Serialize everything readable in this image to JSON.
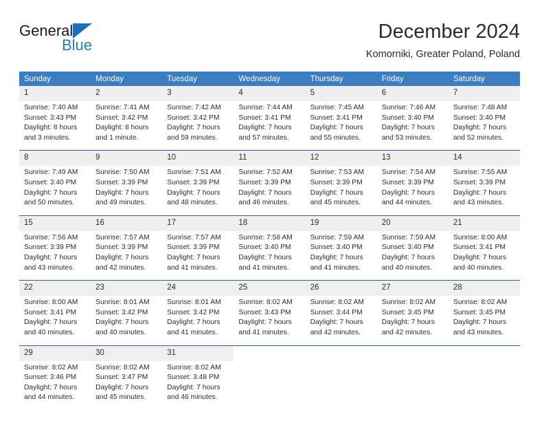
{
  "logo": {
    "word1": "General",
    "word2": "Blue",
    "triangle_color": "#1f6fc0",
    "word2_color": "#1f7ac4"
  },
  "header": {
    "title": "December 2024",
    "location": "Komorniki, Greater Poland, Poland"
  },
  "theme": {
    "header_blue": "#3a7dc0",
    "separator_blue": "#2a5f9e",
    "daynum_bg": "#efefef",
    "text": "#2b2b2b"
  },
  "weekday_headers": [
    "Sunday",
    "Monday",
    "Tuesday",
    "Wednesday",
    "Thursday",
    "Friday",
    "Saturday"
  ],
  "weeks": [
    [
      {
        "day": "1",
        "sunrise": "Sunrise: 7:40 AM",
        "sunset": "Sunset: 3:43 PM",
        "daylight1": "Daylight: 8 hours",
        "daylight2": "and 3 minutes."
      },
      {
        "day": "2",
        "sunrise": "Sunrise: 7:41 AM",
        "sunset": "Sunset: 3:42 PM",
        "daylight1": "Daylight: 8 hours",
        "daylight2": "and 1 minute."
      },
      {
        "day": "3",
        "sunrise": "Sunrise: 7:42 AM",
        "sunset": "Sunset: 3:42 PM",
        "daylight1": "Daylight: 7 hours",
        "daylight2": "and 59 minutes."
      },
      {
        "day": "4",
        "sunrise": "Sunrise: 7:44 AM",
        "sunset": "Sunset: 3:41 PM",
        "daylight1": "Daylight: 7 hours",
        "daylight2": "and 57 minutes."
      },
      {
        "day": "5",
        "sunrise": "Sunrise: 7:45 AM",
        "sunset": "Sunset: 3:41 PM",
        "daylight1": "Daylight: 7 hours",
        "daylight2": "and 55 minutes."
      },
      {
        "day": "6",
        "sunrise": "Sunrise: 7:46 AM",
        "sunset": "Sunset: 3:40 PM",
        "daylight1": "Daylight: 7 hours",
        "daylight2": "and 53 minutes."
      },
      {
        "day": "7",
        "sunrise": "Sunrise: 7:48 AM",
        "sunset": "Sunset: 3:40 PM",
        "daylight1": "Daylight: 7 hours",
        "daylight2": "and 52 minutes."
      }
    ],
    [
      {
        "day": "8",
        "sunrise": "Sunrise: 7:49 AM",
        "sunset": "Sunset: 3:40 PM",
        "daylight1": "Daylight: 7 hours",
        "daylight2": "and 50 minutes."
      },
      {
        "day": "9",
        "sunrise": "Sunrise: 7:50 AM",
        "sunset": "Sunset: 3:39 PM",
        "daylight1": "Daylight: 7 hours",
        "daylight2": "and 49 minutes."
      },
      {
        "day": "10",
        "sunrise": "Sunrise: 7:51 AM",
        "sunset": "Sunset: 3:39 PM",
        "daylight1": "Daylight: 7 hours",
        "daylight2": "and 48 minutes."
      },
      {
        "day": "11",
        "sunrise": "Sunrise: 7:52 AM",
        "sunset": "Sunset: 3:39 PM",
        "daylight1": "Daylight: 7 hours",
        "daylight2": "and 46 minutes."
      },
      {
        "day": "12",
        "sunrise": "Sunrise: 7:53 AM",
        "sunset": "Sunset: 3:39 PM",
        "daylight1": "Daylight: 7 hours",
        "daylight2": "and 45 minutes."
      },
      {
        "day": "13",
        "sunrise": "Sunrise: 7:54 AM",
        "sunset": "Sunset: 3:39 PM",
        "daylight1": "Daylight: 7 hours",
        "daylight2": "and 44 minutes."
      },
      {
        "day": "14",
        "sunrise": "Sunrise: 7:55 AM",
        "sunset": "Sunset: 3:39 PM",
        "daylight1": "Daylight: 7 hours",
        "daylight2": "and 43 minutes."
      }
    ],
    [
      {
        "day": "15",
        "sunrise": "Sunrise: 7:56 AM",
        "sunset": "Sunset: 3:39 PM",
        "daylight1": "Daylight: 7 hours",
        "daylight2": "and 43 minutes."
      },
      {
        "day": "16",
        "sunrise": "Sunrise: 7:57 AM",
        "sunset": "Sunset: 3:39 PM",
        "daylight1": "Daylight: 7 hours",
        "daylight2": "and 42 minutes."
      },
      {
        "day": "17",
        "sunrise": "Sunrise: 7:57 AM",
        "sunset": "Sunset: 3:39 PM",
        "daylight1": "Daylight: 7 hours",
        "daylight2": "and 41 minutes."
      },
      {
        "day": "18",
        "sunrise": "Sunrise: 7:58 AM",
        "sunset": "Sunset: 3:40 PM",
        "daylight1": "Daylight: 7 hours",
        "daylight2": "and 41 minutes."
      },
      {
        "day": "19",
        "sunrise": "Sunrise: 7:59 AM",
        "sunset": "Sunset: 3:40 PM",
        "daylight1": "Daylight: 7 hours",
        "daylight2": "and 41 minutes."
      },
      {
        "day": "20",
        "sunrise": "Sunrise: 7:59 AM",
        "sunset": "Sunset: 3:40 PM",
        "daylight1": "Daylight: 7 hours",
        "daylight2": "and 40 minutes."
      },
      {
        "day": "21",
        "sunrise": "Sunrise: 8:00 AM",
        "sunset": "Sunset: 3:41 PM",
        "daylight1": "Daylight: 7 hours",
        "daylight2": "and 40 minutes."
      }
    ],
    [
      {
        "day": "22",
        "sunrise": "Sunrise: 8:00 AM",
        "sunset": "Sunset: 3:41 PM",
        "daylight1": "Daylight: 7 hours",
        "daylight2": "and 40 minutes."
      },
      {
        "day": "23",
        "sunrise": "Sunrise: 8:01 AM",
        "sunset": "Sunset: 3:42 PM",
        "daylight1": "Daylight: 7 hours",
        "daylight2": "and 40 minutes."
      },
      {
        "day": "24",
        "sunrise": "Sunrise: 8:01 AM",
        "sunset": "Sunset: 3:42 PM",
        "daylight1": "Daylight: 7 hours",
        "daylight2": "and 41 minutes."
      },
      {
        "day": "25",
        "sunrise": "Sunrise: 8:02 AM",
        "sunset": "Sunset: 3:43 PM",
        "daylight1": "Daylight: 7 hours",
        "daylight2": "and 41 minutes."
      },
      {
        "day": "26",
        "sunrise": "Sunrise: 8:02 AM",
        "sunset": "Sunset: 3:44 PM",
        "daylight1": "Daylight: 7 hours",
        "daylight2": "and 42 minutes."
      },
      {
        "day": "27",
        "sunrise": "Sunrise: 8:02 AM",
        "sunset": "Sunset: 3:45 PM",
        "daylight1": "Daylight: 7 hours",
        "daylight2": "and 42 minutes."
      },
      {
        "day": "28",
        "sunrise": "Sunrise: 8:02 AM",
        "sunset": "Sunset: 3:45 PM",
        "daylight1": "Daylight: 7 hours",
        "daylight2": "and 43 minutes."
      }
    ],
    [
      {
        "day": "29",
        "sunrise": "Sunrise: 8:02 AM",
        "sunset": "Sunset: 3:46 PM",
        "daylight1": "Daylight: 7 hours",
        "daylight2": "and 44 minutes."
      },
      {
        "day": "30",
        "sunrise": "Sunrise: 8:02 AM",
        "sunset": "Sunset: 3:47 PM",
        "daylight1": "Daylight: 7 hours",
        "daylight2": "and 45 minutes."
      },
      {
        "day": "31",
        "sunrise": "Sunrise: 8:02 AM",
        "sunset": "Sunset: 3:48 PM",
        "daylight1": "Daylight: 7 hours",
        "daylight2": "and 46 minutes."
      },
      {
        "day": "",
        "sunrise": "",
        "sunset": "",
        "daylight1": "",
        "daylight2": ""
      },
      {
        "day": "",
        "sunrise": "",
        "sunset": "",
        "daylight1": "",
        "daylight2": ""
      },
      {
        "day": "",
        "sunrise": "",
        "sunset": "",
        "daylight1": "",
        "daylight2": ""
      },
      {
        "day": "",
        "sunrise": "",
        "sunset": "",
        "daylight1": "",
        "daylight2": ""
      }
    ]
  ]
}
